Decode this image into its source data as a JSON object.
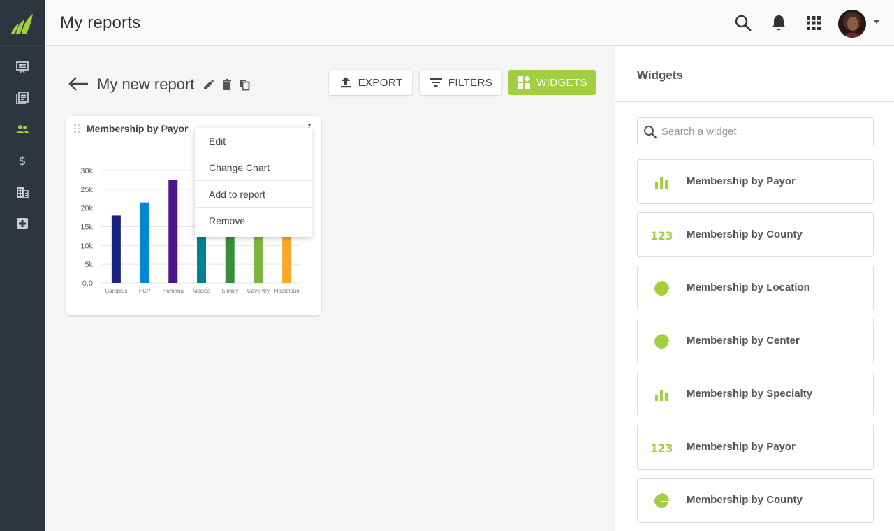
{
  "app": {
    "accent_color": "#a1cf3f",
    "sidebar_color": "#2f353f"
  },
  "header": {
    "title": "My reports"
  },
  "sidebar": {
    "items": [
      {
        "icon": "presentation-icon",
        "active": false
      },
      {
        "icon": "documents-icon",
        "active": false
      },
      {
        "icon": "people-icon",
        "active": true
      },
      {
        "icon": "dollar-icon",
        "active": false
      },
      {
        "icon": "building-icon",
        "active": false
      },
      {
        "icon": "medical-plus-icon",
        "active": false
      }
    ]
  },
  "report": {
    "title": "My new report",
    "buttons": {
      "export": "EXPORT",
      "filters": "FILTERS",
      "widgets": "WIDGETS"
    }
  },
  "widget_card": {
    "title": "Membership by Payor",
    "menu": [
      "Edit",
      "Change Chart",
      "Add to report",
      "Remove"
    ]
  },
  "chart_data": {
    "type": "bar",
    "categories": [
      "Careplus",
      "PCP",
      "Humana",
      "Medica",
      "Simply",
      "Coventry",
      "Healthsun"
    ],
    "values": [
      18000,
      21500,
      27500,
      21500,
      14500,
      12500,
      12500
    ],
    "colors": [
      "#1a237e",
      "#0288d1",
      "#4a148c",
      "#00838f",
      "#388e3c",
      "#7cb342",
      "#f9a825"
    ],
    "y_ticks": [
      "0.0",
      "5k",
      "10k",
      "15k",
      "20k",
      "25k",
      "30k"
    ],
    "ylim": [
      0,
      30000
    ],
    "grid": true
  },
  "panel": {
    "title": "Widgets",
    "search_placeholder": "Search a widget",
    "widgets": [
      {
        "icon": "bar-chart-icon",
        "label": "Membership by Payor"
      },
      {
        "icon": "number-icon",
        "icon_text": "123",
        "label": "Membership by County"
      },
      {
        "icon": "pie-chart-icon",
        "label": "Membership by Location"
      },
      {
        "icon": "pie-chart-icon",
        "label": "Membership by Center"
      },
      {
        "icon": "bar-chart-icon",
        "label": "Membership by Specialty"
      },
      {
        "icon": "number-icon",
        "icon_text": "123",
        "label": "Membership by Payor"
      },
      {
        "icon": "pie-chart-icon",
        "label": "Membership by County"
      }
    ]
  }
}
